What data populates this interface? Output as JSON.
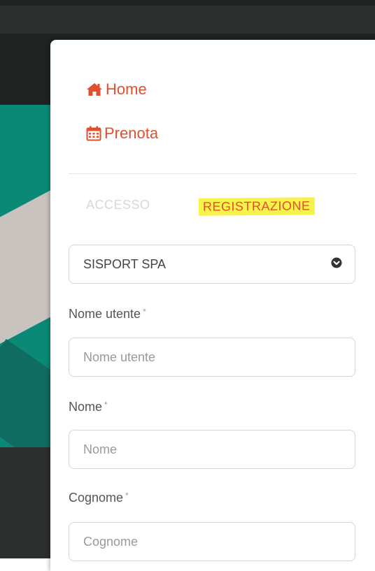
{
  "nav": {
    "home": {
      "label": "Home",
      "icon": "home-icon"
    },
    "prenota": {
      "label": "Prenota",
      "icon": "calendar-icon"
    }
  },
  "tabs": {
    "accesso": "ACCESSO",
    "registrazione": "REGISTRAZIONE",
    "active": "registrazione"
  },
  "company_select": {
    "selected": "SISPORT SPA",
    "icon": "chevron-down-circle-icon"
  },
  "form": {
    "username": {
      "label": "Nome utente",
      "required_mark": "*",
      "placeholder": "Nome utente"
    },
    "nome": {
      "label": "Nome",
      "required_mark": "*",
      "placeholder": "Nome"
    },
    "cognome": {
      "label": "Cognome",
      "required_mark": "*",
      "placeholder": "Cognome"
    }
  },
  "colors": {
    "accent": "#e0502e",
    "highlight": "#f7f34a",
    "inactive_tab": "#d8d8d8",
    "border": "#d5d5d5",
    "background_teal": "#0a8a76",
    "background_dark": "#1f2423"
  }
}
